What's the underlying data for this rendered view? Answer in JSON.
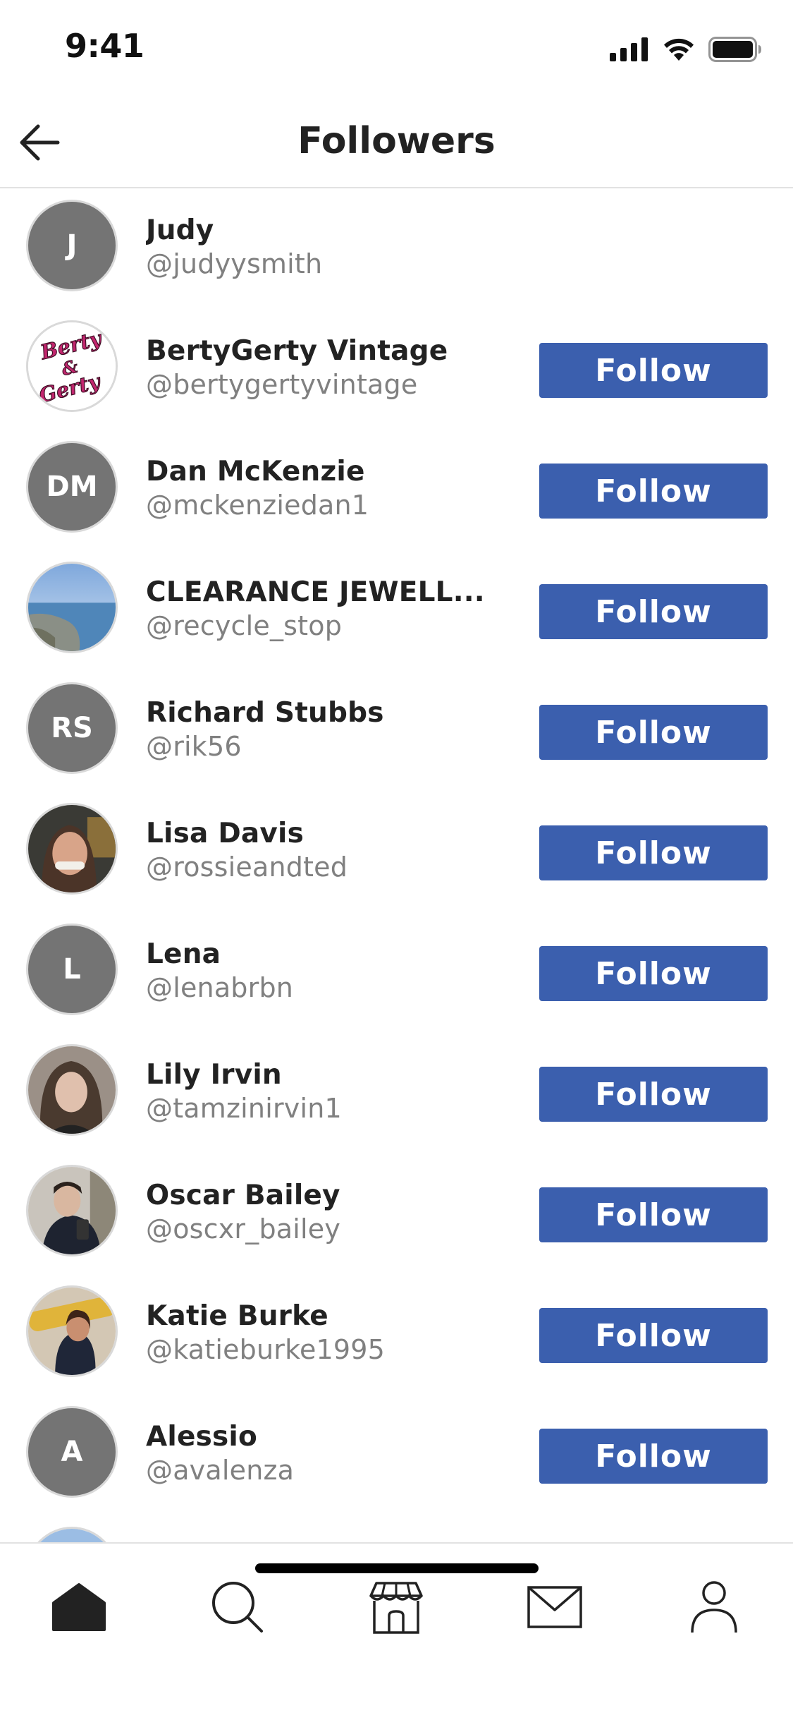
{
  "status_bar": {
    "time": "9:41"
  },
  "header": {
    "title": "Followers"
  },
  "followers": [
    {
      "name": "Judy",
      "handle": "@judyysmith",
      "avatar_type": "initials",
      "initials": "J",
      "show_follow": false
    },
    {
      "name": "BertyGerty Vintage",
      "handle": "@bertygertyvintage",
      "avatar_type": "logo",
      "logo_text": "Berty & Gerty",
      "show_follow": true
    },
    {
      "name": "Dan McKenzie",
      "handle": "@mckenziedan1",
      "avatar_type": "initials",
      "initials": "DM",
      "show_follow": true
    },
    {
      "name": "CLEARANCE JEWELL...",
      "handle": "@recycle_stop",
      "avatar_type": "photo-sea",
      "show_follow": true
    },
    {
      "name": "Richard Stubbs",
      "handle": "@rik56",
      "avatar_type": "initials",
      "initials": "RS",
      "show_follow": true
    },
    {
      "name": "Lisa Davis",
      "handle": "@rossieandted",
      "avatar_type": "photo-person-1",
      "show_follow": true
    },
    {
      "name": "Lena",
      "handle": "@lenabrbn",
      "avatar_type": "initials",
      "initials": "L",
      "show_follow": true
    },
    {
      "name": "Lily Irvin",
      "handle": "@tamzinirvin1",
      "avatar_type": "photo-person-2",
      "show_follow": true
    },
    {
      "name": "Oscar Bailey",
      "handle": "@oscxr_bailey",
      "avatar_type": "photo-person-3",
      "show_follow": true
    },
    {
      "name": "Katie Burke",
      "handle": "@katieburke1995",
      "avatar_type": "photo-person-4",
      "show_follow": true
    },
    {
      "name": "Alessio",
      "handle": "@avalenza",
      "avatar_type": "initials",
      "initials": "A",
      "show_follow": true
    },
    {
      "name": "",
      "handle": "",
      "avatar_type": "photo-sky",
      "show_follow": false
    }
  ],
  "follow_label": "Follow",
  "tabs": [
    {
      "name": "home",
      "icon": "home-icon",
      "active": true
    },
    {
      "name": "search",
      "icon": "search-icon",
      "active": false
    },
    {
      "name": "shop",
      "icon": "shop-icon",
      "active": false
    },
    {
      "name": "messages",
      "icon": "mail-icon",
      "active": false
    },
    {
      "name": "profile",
      "icon": "profile-icon",
      "active": false
    }
  ],
  "colors": {
    "follow_button": "#3b5fae",
    "avatar_placeholder": "#747474",
    "handle_text": "#808080"
  }
}
